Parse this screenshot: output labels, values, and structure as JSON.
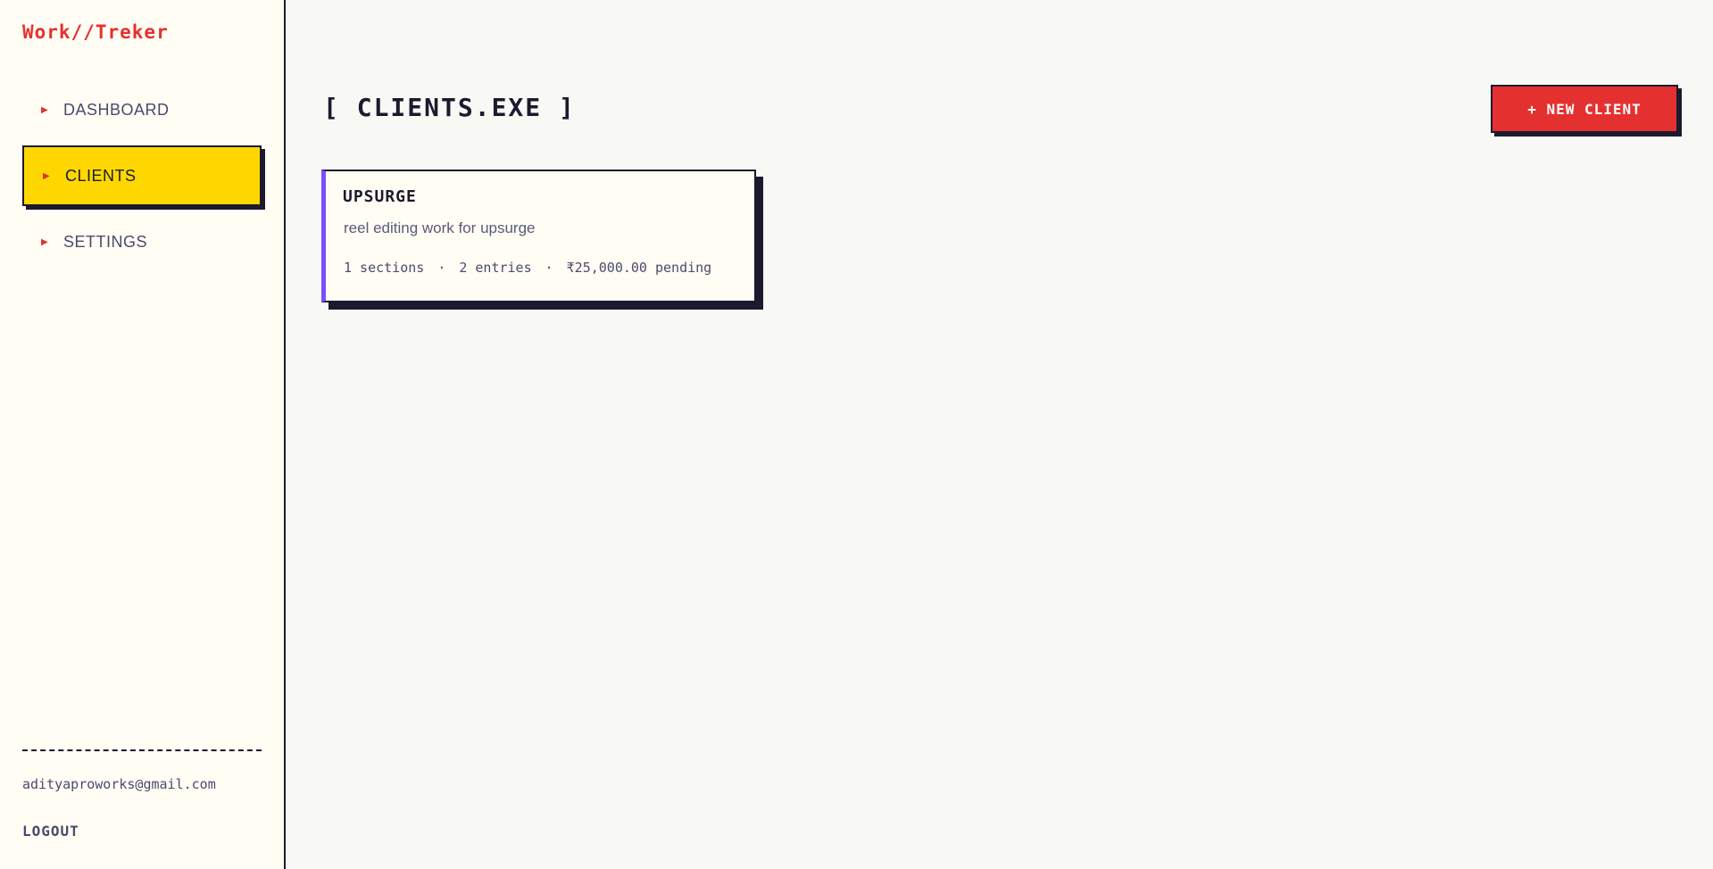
{
  "app": {
    "logo": "Work//Treker"
  },
  "sidebar": {
    "items": [
      {
        "label": "DASHBOARD",
        "active": false
      },
      {
        "label": "CLIENTS",
        "active": true
      },
      {
        "label": "SETTINGS",
        "active": false
      }
    ],
    "user_email": "adityaproworks@gmail.com",
    "logout_label": "LOGOUT"
  },
  "main": {
    "title": "[ CLIENTS.EXE ]",
    "new_client_label": "+ NEW CLIENT",
    "clients": [
      {
        "name": "UPSURGE",
        "description": "reel editing work for upsurge",
        "sections": "1 sections",
        "entries": "2 entries",
        "pending": "₹25,000.00 pending",
        "separator": "·"
      }
    ]
  },
  "colors": {
    "accent_red": "#e53030",
    "active_yellow": "#ffd700",
    "card_accent_purple": "#7c4dff",
    "ink": "#1b1a2e"
  },
  "icons": {
    "nav_arrow": "triangle-right-icon"
  }
}
